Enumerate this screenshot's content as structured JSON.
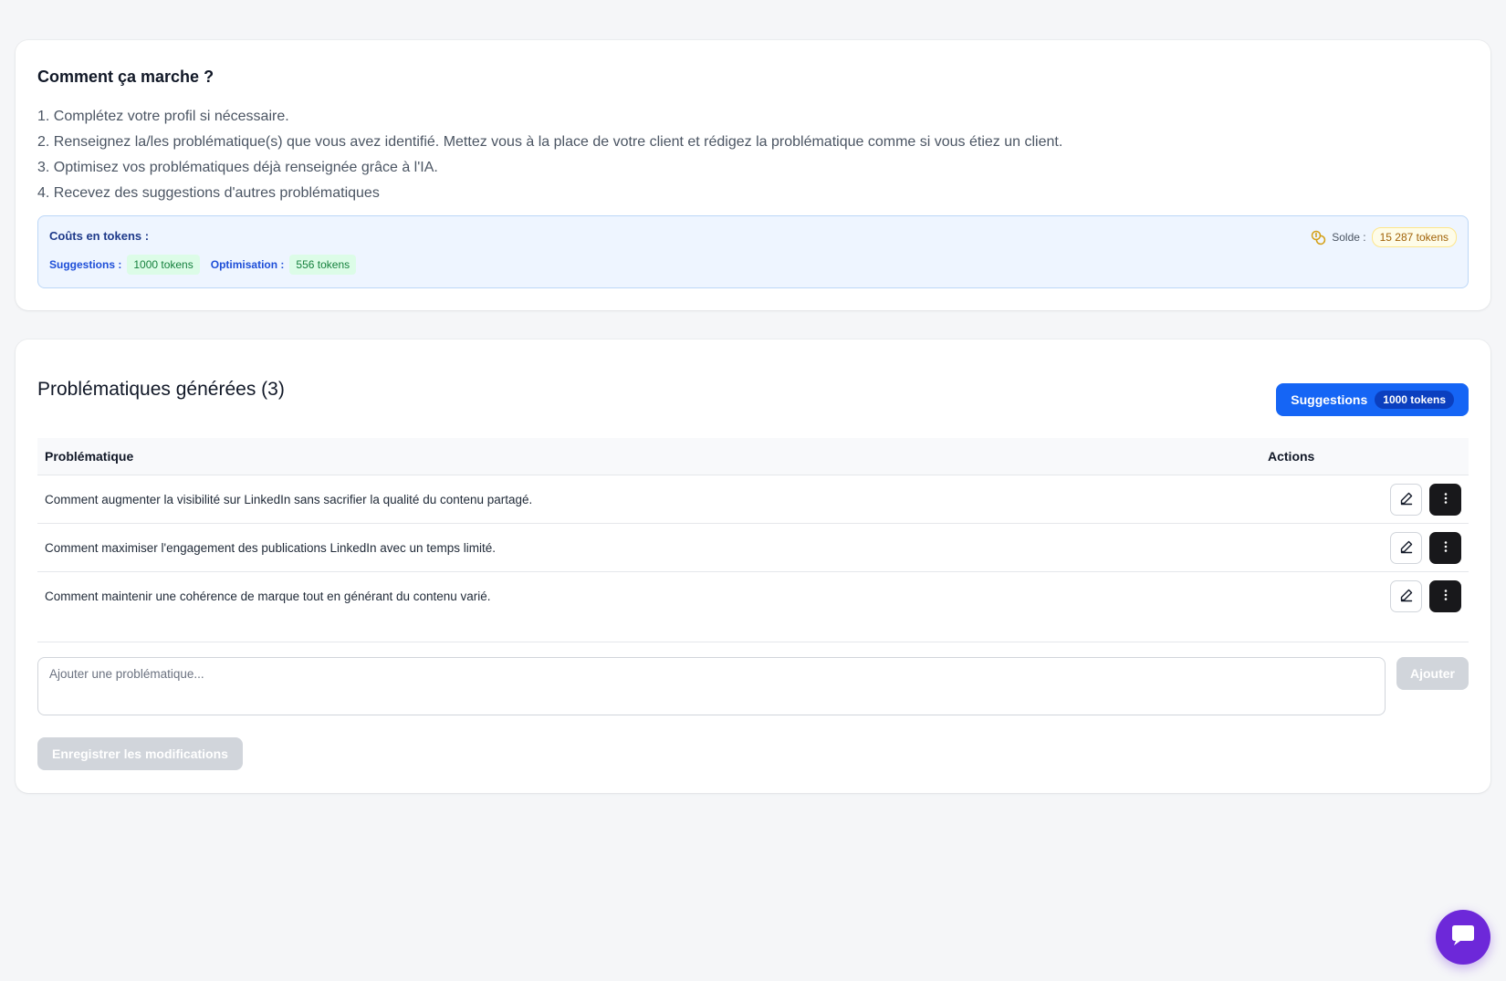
{
  "how_it_works": {
    "title": "Comment ça marche ?",
    "steps": [
      "1. Complétez votre profil si nécessaire.",
      "2. Renseignez la/les problématique(s) que vous avez identifié. Mettez vous à la place de votre client et rédigez la problématique comme si vous étiez un client.",
      "3. Optimisez vos problématiques déjà renseignée grâce à l'IA.",
      "4. Recevez des suggestions d'autres problématiques"
    ],
    "costs": {
      "title": "Coûts en tokens :",
      "suggestions_label": "Suggestions :",
      "suggestions_value": "1000 tokens",
      "optimisation_label": "Optimisation :",
      "optimisation_value": "556 tokens",
      "balance_label": "Solde :",
      "balance_value": "15 287 tokens",
      "balance_icon": "coins-icon"
    }
  },
  "problems": {
    "title": "Problématiques générées (3)",
    "suggest_button": {
      "label": "Suggestions",
      "cost": "1000 tokens"
    },
    "columns": {
      "problem": "Problématique",
      "actions": "Actions"
    },
    "rows": [
      "Comment augmenter la visibilité sur LinkedIn sans sacrifier la qualité du contenu partagé.",
      "Comment maximiser l'engagement des publications LinkedIn avec un temps limité.",
      "Comment maintenir une cohérence de marque tout en générant du contenu varié."
    ],
    "row_actions": {
      "edit_icon": "pencil-icon",
      "more_icon": "vertical-dots-icon"
    },
    "add_input": {
      "placeholder": "Ajouter une problématique...",
      "value": ""
    },
    "add_button": "Ajouter",
    "save_button": "Enregistrer les modifications"
  },
  "chat": {
    "icon": "chat-bubble-icon"
  },
  "colors": {
    "primary": "#1565f5",
    "primary_dark": "#0b3fbf",
    "chat_purple": "#6d28d9",
    "info_bg": "#eef5ff",
    "success_chip": "#dcfce7",
    "warning_chip": "#fefce8",
    "disabled": "#d1d5db",
    "dark_button": "#18181b"
  }
}
